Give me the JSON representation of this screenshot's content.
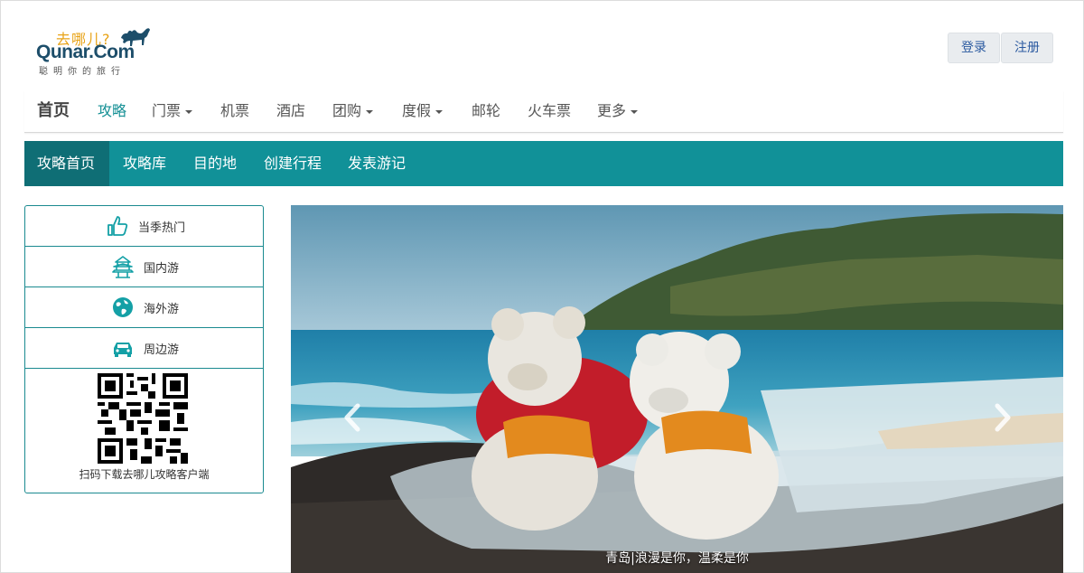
{
  "header": {
    "logo_cn": "去哪儿?",
    "logo_en": "Qunar.Com",
    "logo_slogan": "聪明你的旅行",
    "login_label": "登录",
    "register_label": "注册"
  },
  "topnav": {
    "home": "首页",
    "items": [
      {
        "label": "攻略",
        "active": true,
        "dropdown": false
      },
      {
        "label": "门票",
        "dropdown": true
      },
      {
        "label": "机票",
        "dropdown": false
      },
      {
        "label": "酒店",
        "dropdown": false
      },
      {
        "label": "团购",
        "dropdown": true
      },
      {
        "label": "度假",
        "dropdown": true
      },
      {
        "label": "邮轮",
        "dropdown": false
      },
      {
        "label": "火车票",
        "dropdown": false
      },
      {
        "label": "更多",
        "dropdown": true
      }
    ]
  },
  "subnav": {
    "items": [
      {
        "label": "攻略首页",
        "active": true
      },
      {
        "label": "攻略库"
      },
      {
        "label": "目的地"
      },
      {
        "label": "创建行程"
      },
      {
        "label": "发表游记"
      }
    ]
  },
  "sidebar": {
    "items": [
      {
        "label": "当季热门",
        "icon": "thumbs-up-icon"
      },
      {
        "label": "国内游",
        "icon": "pagoda-icon"
      },
      {
        "label": "海外游",
        "icon": "globe-icon"
      },
      {
        "label": "周边游",
        "icon": "car-icon"
      }
    ],
    "qr_caption": "扫码下载去哪儿攻略客户端"
  },
  "carousel": {
    "caption": "青岛|浪漫是你，温柔是你",
    "slide_count": 4,
    "active_slide": 1
  },
  "colors": {
    "accent": "#119198",
    "accent_dark": "#0f6e75",
    "logo_orange": "#e8a317",
    "logo_navy": "#1d4e6a"
  }
}
